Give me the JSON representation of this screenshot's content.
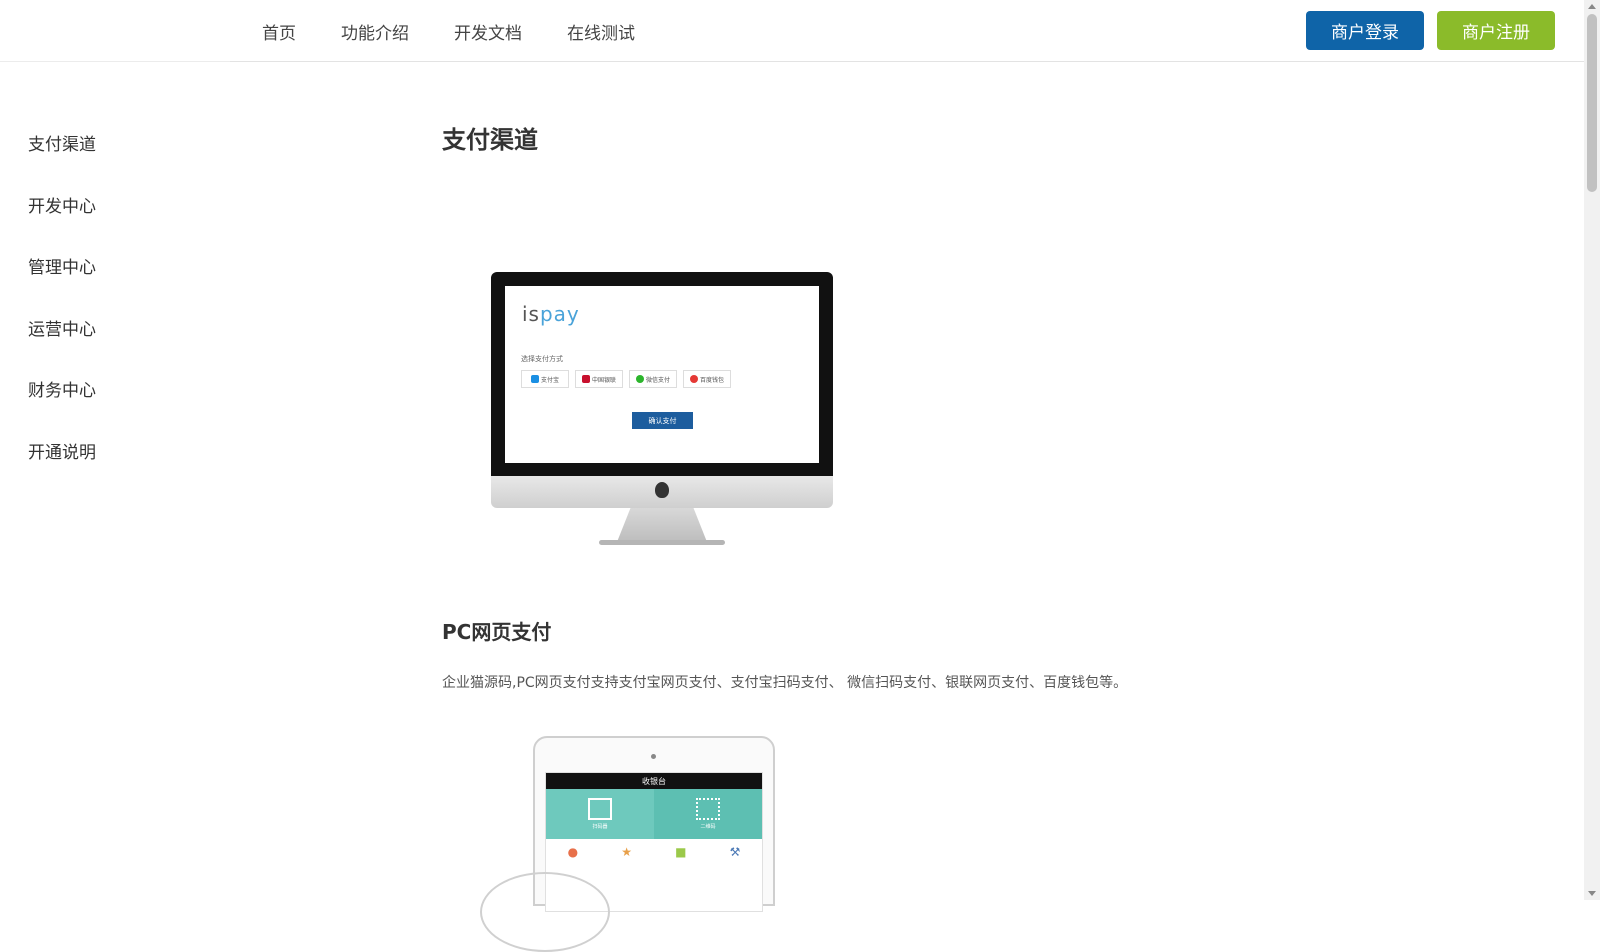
{
  "header": {
    "nav": [
      "首页",
      "功能介绍",
      "开发文档",
      "在线测试"
    ],
    "login_label": "商户登录",
    "register_label": "商户注册"
  },
  "sidebar": {
    "items": [
      "支付渠道",
      "开发中心",
      "管理中心",
      "运营中心",
      "财务中心",
      "开通说明"
    ]
  },
  "main": {
    "title": "支付渠道",
    "monitor": {
      "logo_is": "is",
      "logo_pay": "pay",
      "select_label": "选择支付方式",
      "methods": [
        "支付宝",
        "中国银联",
        "微信支付",
        "百度钱包"
      ],
      "confirm_label": "确认支付"
    },
    "section": {
      "title": "PC网页支付",
      "desc": "企业猫源码,PC网页支付支持支付宝网页支付、支付宝扫码支付、 微信扫码支付、银联网页支付、百度钱包等。"
    },
    "tablet": {
      "header": "收银台",
      "tile_a": "扫码器",
      "tile_b": "二维码"
    }
  },
  "colors": {
    "login": "#0f64a8",
    "register": "#8bbb2a"
  }
}
